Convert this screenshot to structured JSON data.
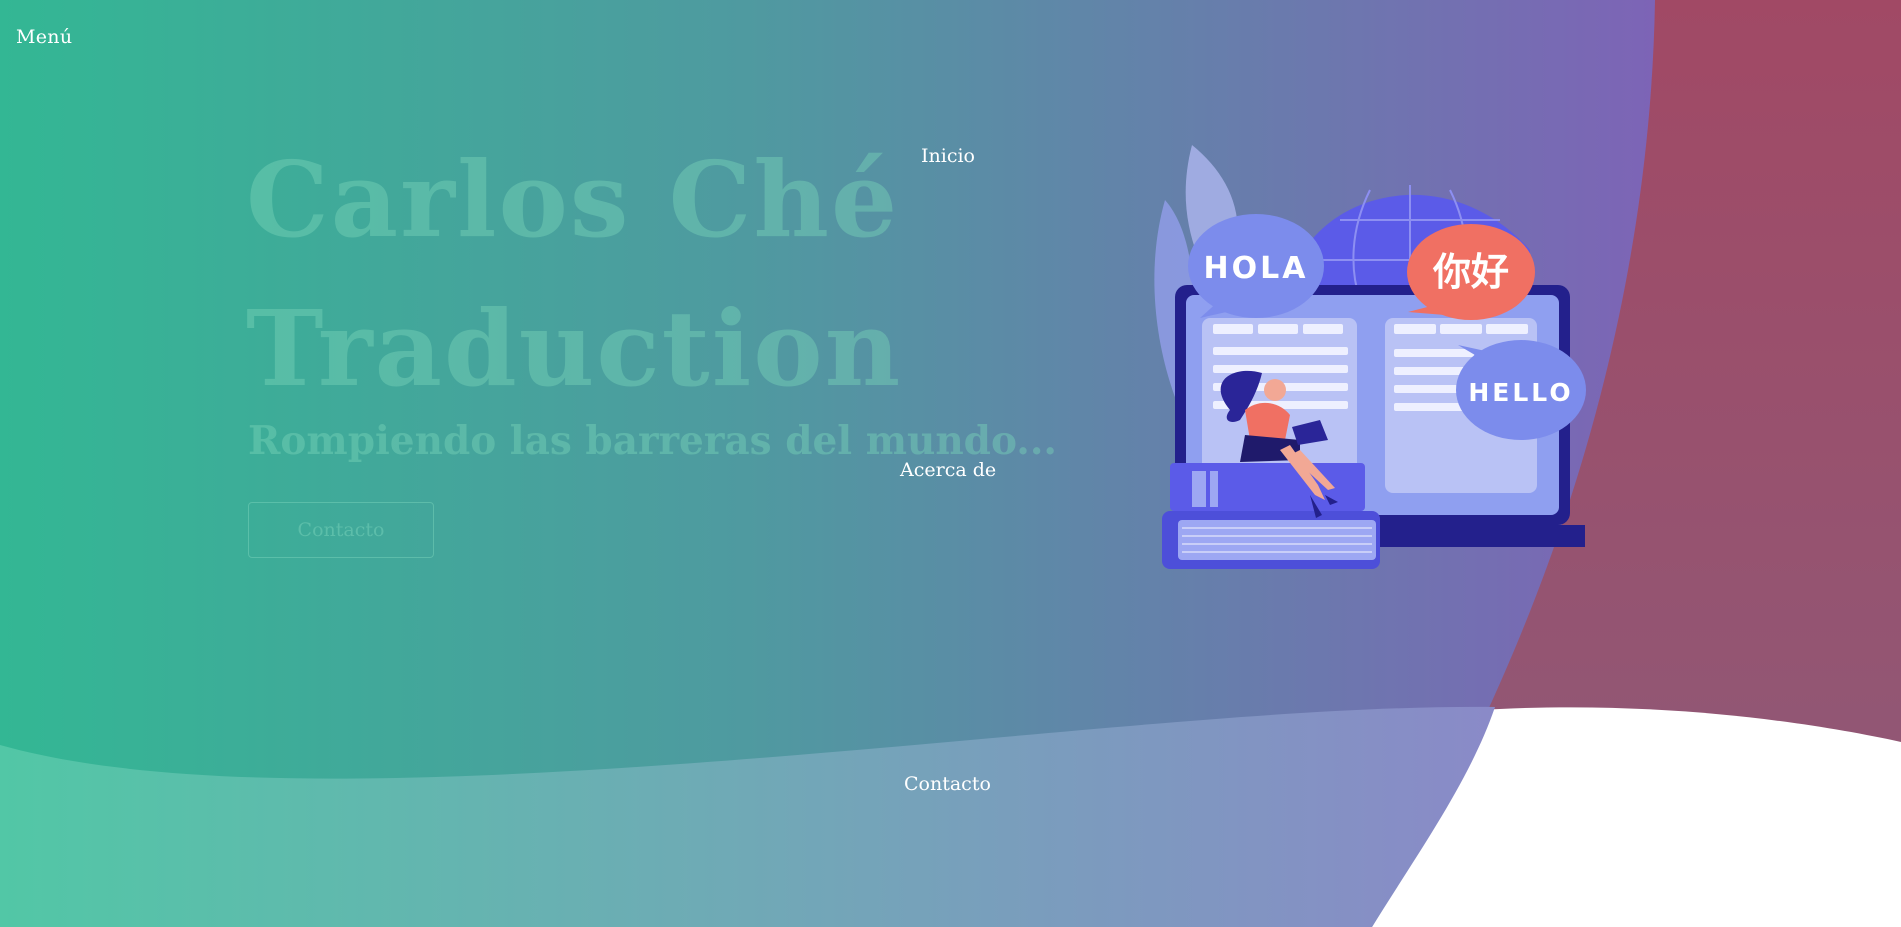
{
  "nav": {
    "menu_label": "Menú",
    "items": [
      {
        "label": "Inicio"
      },
      {
        "label": "Acerca de"
      },
      {
        "label": "Contacto"
      }
    ]
  },
  "hero": {
    "title_line_1": "Carlos Ché",
    "title_line_2": "Traduction",
    "subtitle": "Rompiendo las barreras del mundo...",
    "cta_label": "Contacto"
  },
  "illustration": {
    "bubbles": [
      "HOLA",
      "你好",
      "HELLO"
    ]
  },
  "colors": {
    "gradient_start": "#33b794",
    "gradient_end": "#7d64b6",
    "right_panel": "#a14965",
    "lower_band_start": "#52c7a6",
    "lower_band_end": "#8a8ac8",
    "accent_indigo": "#5b5be8",
    "bubble_red": "#f07063"
  }
}
